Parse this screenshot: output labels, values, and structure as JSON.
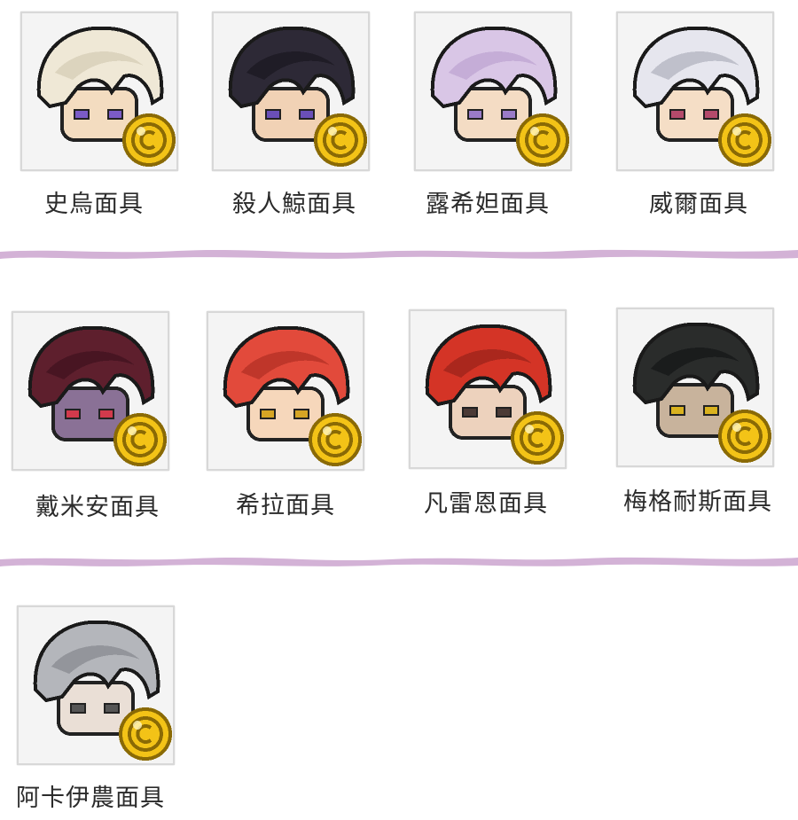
{
  "items": [
    {
      "name": "史烏面具",
      "icon": "hair-white-icon",
      "hair": "#efe8d6",
      "hair_dark": "#cfc6ad",
      "skin": "#f3dcc0",
      "eye": "#7b5bc7"
    },
    {
      "name": "殺人鯨面具",
      "icon": "cap-dark-icon",
      "hair": "#2d2936",
      "hair_dark": "#16141c",
      "skin": "#f1d2b5",
      "eye": "#6a4fb8"
    },
    {
      "name": "露希妲面具",
      "icon": "hair-lilac-icon",
      "hair": "#d9c6e6",
      "hair_dark": "#b89dcd",
      "skin": "#f4dcc4",
      "eye": "#9a7bc8"
    },
    {
      "name": "威爾面具",
      "icon": "hair-silver-icon",
      "hair": "#e6e6ee",
      "hair_dark": "#a5a6b4",
      "skin": "#f5dec6",
      "eye": "#b44a6b"
    },
    {
      "name": "戴米安面具",
      "icon": "hair-maroon-icon",
      "hair": "#5e1f2d",
      "hair_dark": "#3a0f1a",
      "skin": "#8a7196",
      "eye": "#d23a4c"
    },
    {
      "name": "希拉面具",
      "icon": "hair-red-icon",
      "hair": "#e24a3b",
      "hair_dark": "#a82a20",
      "skin": "#f6d7bb",
      "eye": "#d6a524"
    },
    {
      "name": "凡雷恩面具",
      "icon": "hair-crimson-icon",
      "hair": "#d43426",
      "hair_dark": "#8e1f18",
      "skin": "#edd2bd",
      "eye": "#4b3a36"
    },
    {
      "name": "梅格耐斯面具",
      "icon": "hair-black-icon",
      "hair": "#2a2c2b",
      "hair_dark": "#111313",
      "skin": "#c8b39c",
      "eye": "#d9b21f"
    },
    {
      "name": "阿卡伊農面具",
      "icon": "hair-grey-long-icon",
      "hair": "#b4b6bb",
      "hair_dark": "#7d7f86",
      "skin": "#eadfd6",
      "eye": "#555555"
    }
  ],
  "colors": {
    "divider": "#d3b2d6",
    "coin_fill": "#f3c317",
    "coin_edge": "#8a6a05",
    "label_text": "#2b2b2b"
  }
}
